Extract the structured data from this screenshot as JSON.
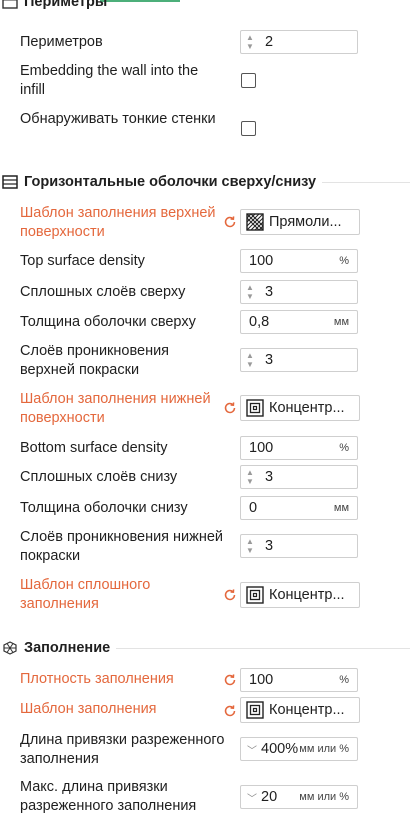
{
  "sections": {
    "perimeters": {
      "title": "Периметры",
      "icon": "walls-icon"
    },
    "shells": {
      "title": "Горизонтальные оболочки сверху/снизу",
      "icon": "shell-layers-icon"
    },
    "infill": {
      "title": "Заполнение",
      "icon": "infill-hex-icon"
    }
  },
  "rows": {
    "perimeters": {
      "label": "Периметров",
      "value": "2"
    },
    "embedding": {
      "label": "Embedding the wall into the infill",
      "checked": false
    },
    "thin_walls": {
      "label": "Обнаруживать тонкие стенки",
      "checked": false
    },
    "top_pattern": {
      "label": "Шаблон заполнения верхней поверхности",
      "value": "Прямоли...",
      "pattern_icon": "rectilinear-pattern-icon"
    },
    "top_density": {
      "label": "Top surface density",
      "value": "100",
      "unit": "%"
    },
    "top_layers": {
      "label": "Сплошных слоёв сверху",
      "value": "3"
    },
    "top_thickness": {
      "label": "Толщина оболочки сверху",
      "value": "0,8",
      "unit": "мм"
    },
    "top_paint_layers": {
      "label": "Слоёв проникновения верхней покраски",
      "value": "3"
    },
    "bottom_pattern": {
      "label": "Шаблон заполнения нижней поверхности",
      "value": "Концентр...",
      "pattern_icon": "concentric-pattern-icon"
    },
    "bottom_density": {
      "label": "Bottom surface density",
      "value": "100",
      "unit": "%"
    },
    "bottom_layers": {
      "label": "Сплошных слоёв снизу",
      "value": "3"
    },
    "bottom_thickness": {
      "label": "Толщина оболочки снизу",
      "value": "0",
      "unit": "мм"
    },
    "bottom_paint_layers": {
      "label": "Слоёв проникновения нижней покраски",
      "value": "3"
    },
    "solid_pattern": {
      "label": "Шаблон сплошного заполнения",
      "value": "Концентр...",
      "pattern_icon": "concentric-pattern-icon"
    },
    "infill_density": {
      "label": "Плотность заполнения",
      "value": "100",
      "unit": "%"
    },
    "infill_pattern": {
      "label": "Шаблон заполнения",
      "value": "Концентр...",
      "pattern_icon": "concentric-pattern-icon"
    },
    "anchor_length": {
      "label": "Длина привязки разреженного заполнения",
      "value": "400%",
      "unit": "мм или %"
    },
    "anchor_max": {
      "label": "Макс. длина привязки разреженного заполнения",
      "value": "20",
      "unit": "мм или %"
    }
  },
  "colors": {
    "modified_label": "#e4683d",
    "accent": "#4caf7a"
  }
}
